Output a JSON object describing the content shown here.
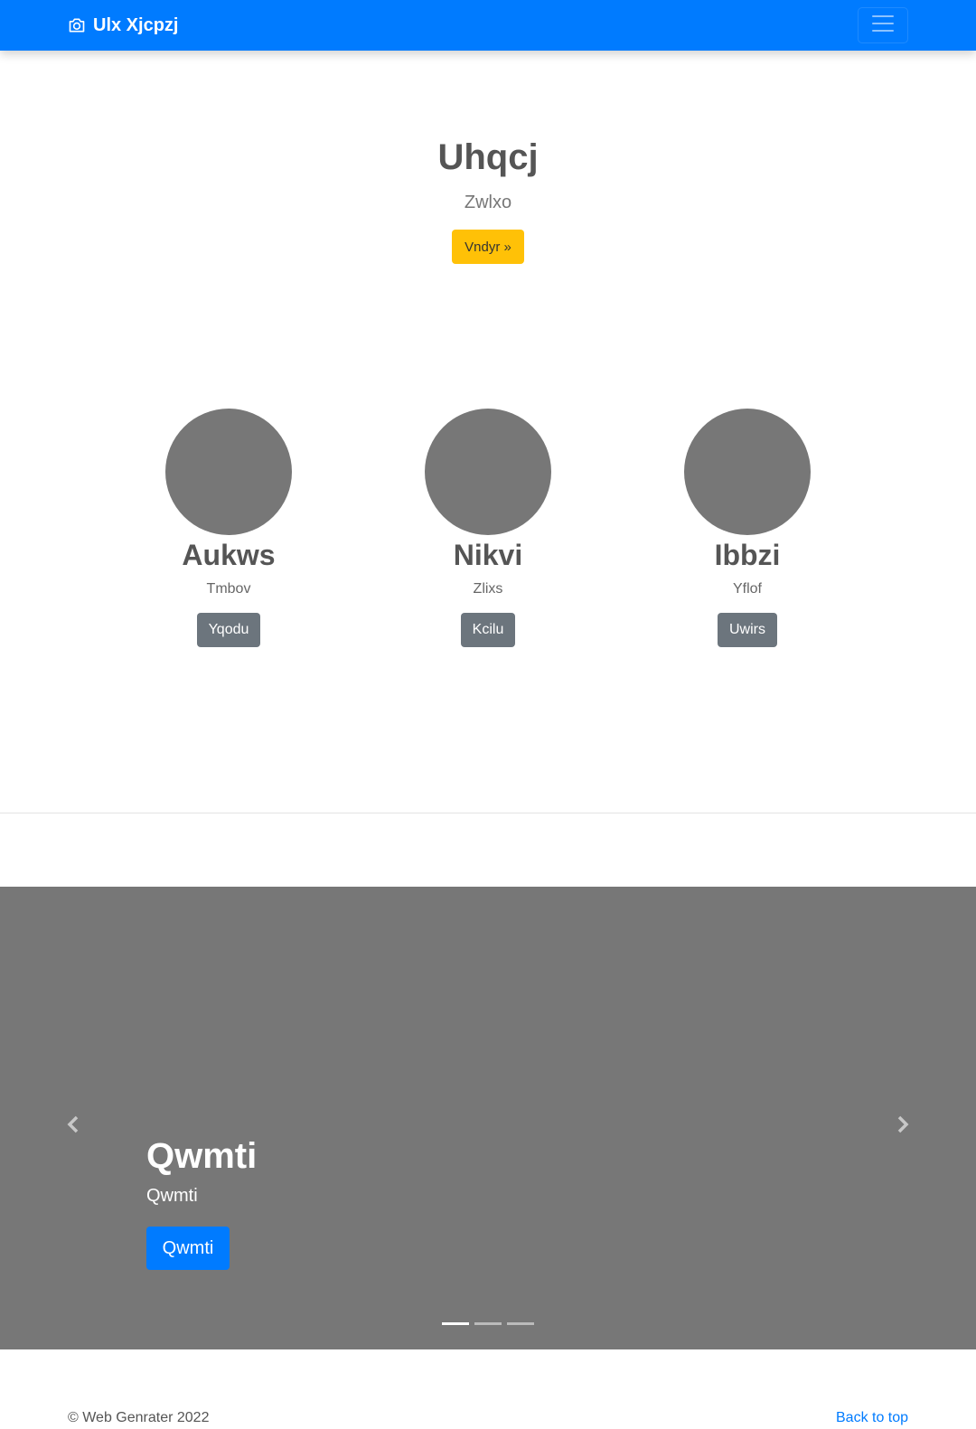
{
  "navbar": {
    "brand": "Ulx Xjcpzj",
    "brand_icon": "camera-icon",
    "toggler_icon": "hamburger-menu-icon"
  },
  "hero": {
    "title": "Uhqcj",
    "subtitle": "Zwlxo",
    "button_label": "Vndyr »"
  },
  "cards": [
    {
      "name": "Aukws",
      "subtitle": "Tmbov",
      "button_label": "Yqodu"
    },
    {
      "name": "Nikvi",
      "subtitle": "Zlixs",
      "button_label": "Kcilu"
    },
    {
      "name": "Ibbzi",
      "subtitle": "Yflof",
      "button_label": "Uwirs"
    }
  ],
  "carousel": {
    "slide_title": "Qwmti",
    "slide_text": "Qwmti",
    "slide_button": "Qwmti",
    "prev_icon": "chevron-left-icon",
    "next_icon": "chevron-right-icon",
    "indicator_count": 3,
    "active_indicator": 1
  },
  "footer": {
    "copyright": "© Web Genrater 2022",
    "back_to_top": "Back to top"
  },
  "colors": {
    "primary": "#007bff",
    "warning": "#ffc107",
    "secondary": "#6c757d",
    "placeholder_gray": "#777777"
  }
}
